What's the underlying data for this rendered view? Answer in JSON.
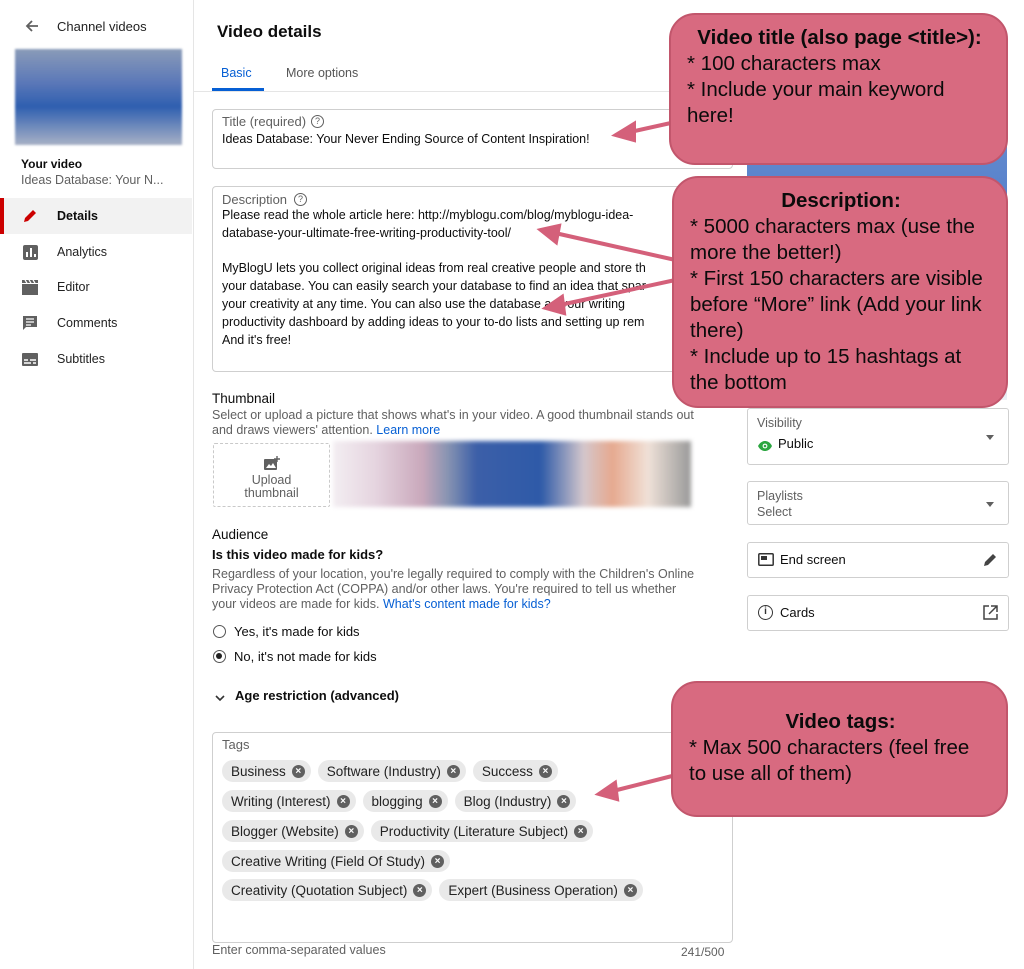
{
  "sidebar": {
    "title": "Channel videos",
    "your_video_label": "Your video",
    "video_title": "Ideas Database: Your N...",
    "items": [
      {
        "label": "Details",
        "icon": "pencil-icon",
        "active": true
      },
      {
        "label": "Analytics",
        "icon": "analytics-icon",
        "active": false
      },
      {
        "label": "Editor",
        "icon": "clapper-icon",
        "active": false
      },
      {
        "label": "Comments",
        "icon": "comments-icon",
        "active": false
      },
      {
        "label": "Subtitles",
        "icon": "subtitles-icon",
        "active": false
      }
    ]
  },
  "main": {
    "heading": "Video details",
    "tabs": [
      {
        "label": "Basic",
        "active": true
      },
      {
        "label": "More options",
        "active": false
      }
    ],
    "title_field": {
      "label": "Title (required)",
      "value": "Ideas Database: Your Never Ending Source of Content Inspiration!"
    },
    "description_field": {
      "label": "Description",
      "lines": [
        "Please read the whole article here: http://myblogu.com/blog/myblogu-idea-",
        "database-your-ultimate-free-writing-productivity-tool/",
        "",
        "MyBlogU lets you collect original ideas from real creative people and store th",
        "your database. You can easily search your database to find an idea that spar",
        "your creativity at any time. You can also use the database as your writing",
        "productivity dashboard by adding ideas to your to-do lists and setting up rem",
        "And it's free!"
      ]
    },
    "thumbnail": {
      "heading": "Thumbnail",
      "help_line1": "Select or upload a picture that shows what's in your video. A good thumbnail stands out",
      "help_line2": "and draws viewers' attention.",
      "learn_more": "Learn more",
      "upload_line1": "Upload",
      "upload_line2": "thumbnail"
    },
    "audience": {
      "heading": "Audience",
      "question": "Is this video made for kids?",
      "help_line1": "Regardless of your location, you're legally required to comply with the Children's Online",
      "help_line2": "Privacy Protection Act (COPPA) and/or other laws. You're required to tell us whether",
      "help_line3": "your videos are made for kids.",
      "help_link": "What's content made for kids?",
      "option_yes": "Yes, it's made for kids",
      "option_no": "No, it's not made for kids",
      "selected": "no",
      "age_restriction": "Age restriction (advanced)"
    },
    "tags": {
      "label": "Tags",
      "rows": [
        [
          "Business",
          "Software (Industry)",
          "Success"
        ],
        [
          "Writing (Interest)",
          "blogging",
          "Blog (Industry)"
        ],
        [
          "Blogger (Website)",
          "Productivity (Literature Subject)"
        ],
        [
          "Creative Writing (Field Of Study)"
        ],
        [
          "Creativity (Quotation Subject)",
          "Expert (Business Operation)"
        ]
      ],
      "placeholder": "Enter comma-separated values",
      "counter": "241/500"
    }
  },
  "right_panel": {
    "visibility": {
      "label": "Visibility",
      "value": "Public"
    },
    "playlists": {
      "label": "Playlists",
      "value": "Select"
    },
    "end_screen": "End screen",
    "cards": "Cards"
  },
  "callouts": {
    "title": {
      "heading": "Video title (also page <title>):",
      "lines": [
        "* 100 characters max",
        "* Include your main keyword here!"
      ]
    },
    "description": {
      "heading": "Description:",
      "lines": [
        "* 5000 characters max (use the more the better!)",
        "* First 150 characters are visible before “More” link (Add your link there)",
        "* Include up to 15 hashtags at the bottom"
      ]
    },
    "tags": {
      "heading": "Video tags:",
      "lines": [
        "* Max 500 characters (feel free to use all of them)"
      ]
    }
  },
  "colors": {
    "accent": "#cc0000",
    "link": "#065fd4",
    "callout_fill": "#d86a80",
    "arrow": "#d4607a",
    "public_green": "#2ba640"
  }
}
